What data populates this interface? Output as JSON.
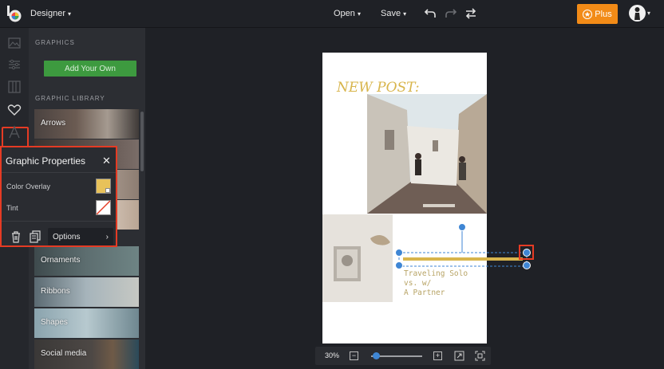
{
  "header": {
    "app_menu_label": "Designer",
    "open_label": "Open",
    "save_label": "Save",
    "plus_label": "Plus"
  },
  "panel": {
    "graphics_title": "GRAPHICS",
    "add_button": "Add Your Own",
    "library_title": "GRAPHIC LIBRARY",
    "tiles": [
      {
        "label": "Arrows"
      },
      {
        "label": "Ornaments"
      },
      {
        "label": "Ribbons"
      },
      {
        "label": "Shapes"
      },
      {
        "label": "Social media"
      }
    ]
  },
  "popup": {
    "title": "Graphic Properties",
    "color_overlay_label": "Color Overlay",
    "color_overlay_value": "#e8c25a",
    "tint_label": "Tint",
    "options_label": "Options"
  },
  "design": {
    "headline": "NEW POST:",
    "caption": "Traveling Solo\nvs. w/\nA Partner",
    "accent_color": "#d8b54c"
  },
  "zoom": {
    "level_label": "30%",
    "level_fraction": 0.3
  },
  "colors": {
    "highlight": "#e53b24",
    "plus_orange": "#f28b17",
    "selection_blue": "#3f86d4",
    "green_button": "#3d9a3f"
  }
}
